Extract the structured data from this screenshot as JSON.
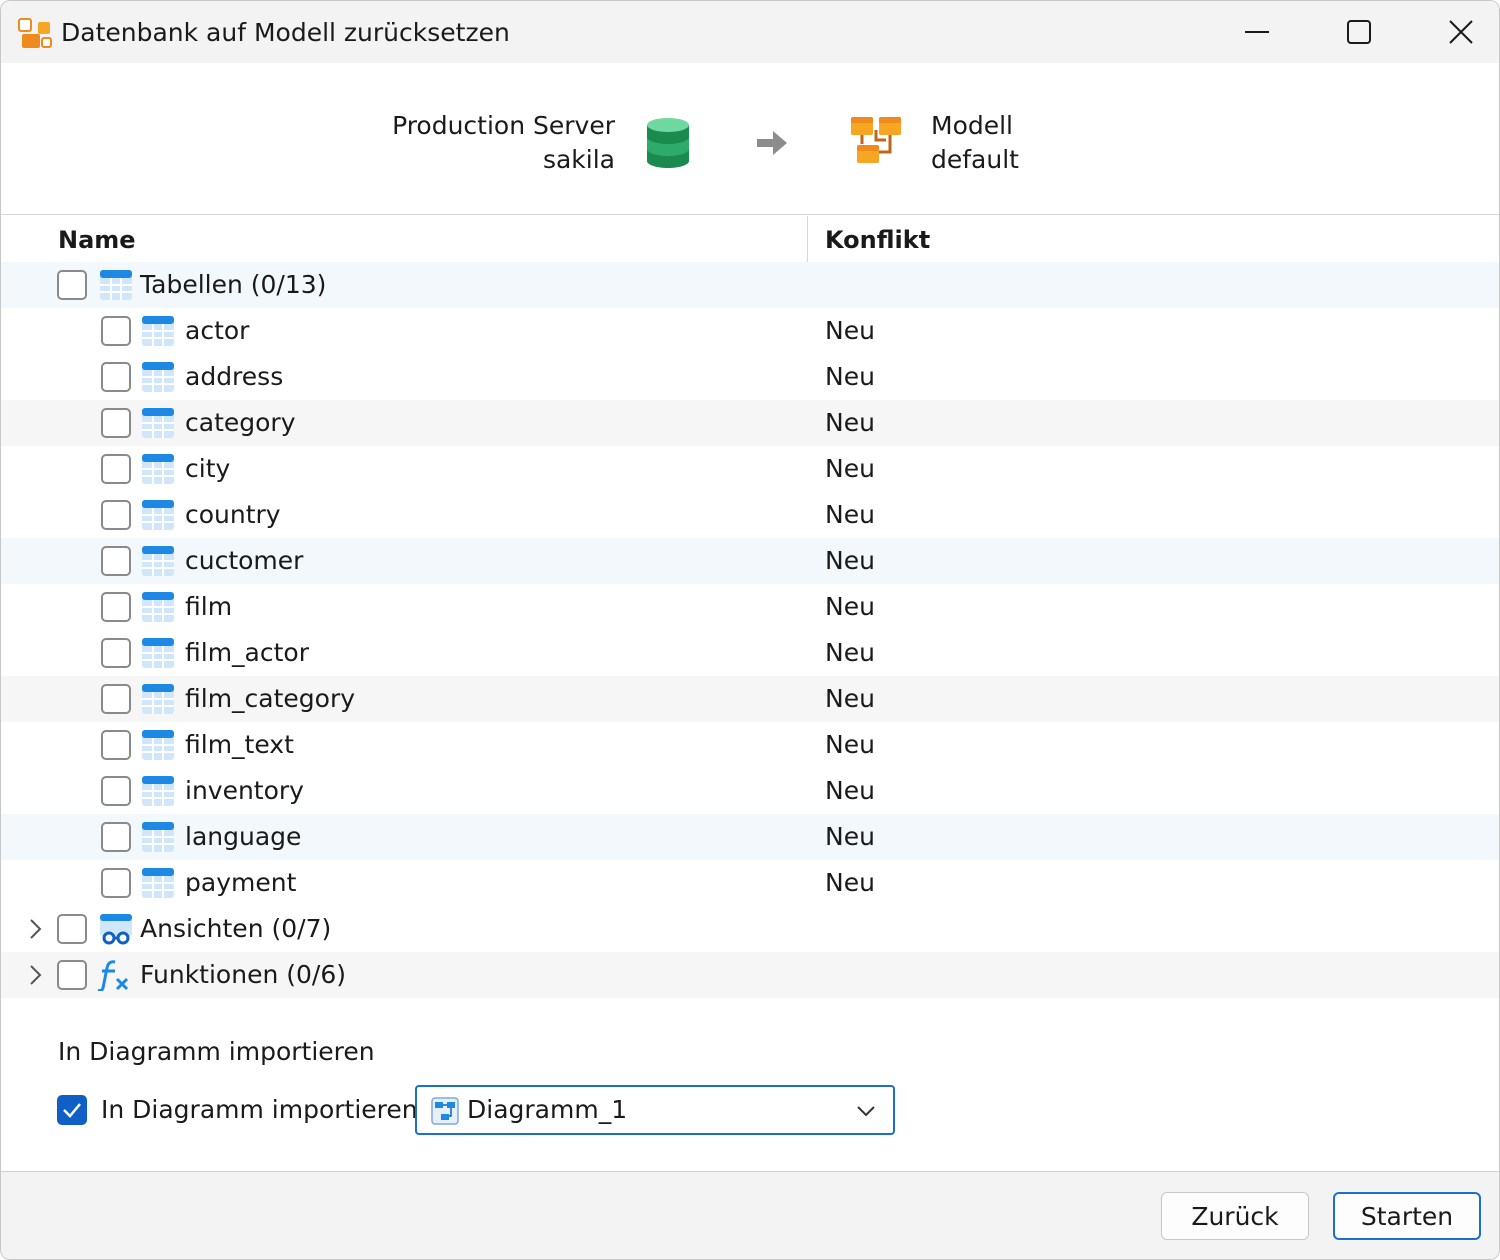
{
  "window": {
    "title": "Datenbank auf Modell zurücksetzen",
    "icons": {
      "app": "model-sync-icon",
      "minimize": "minimize-icon",
      "maximize": "maximize-icon",
      "close": "close-icon"
    }
  },
  "header": {
    "source_name": "Production Server",
    "source_db": "sakila",
    "target_name": "Modell",
    "target_db": "default",
    "icons": {
      "source": "database-icon",
      "arrow": "arrow-right-icon",
      "target": "model-icon"
    }
  },
  "table": {
    "columns": [
      "Name",
      "Konflikt"
    ],
    "groups": [
      {
        "label": "Tabellen (0/13)",
        "icon": "table-icon",
        "expanded": true,
        "items": [
          {
            "name": "actor",
            "conflict": "Neu"
          },
          {
            "name": "address",
            "conflict": "Neu"
          },
          {
            "name": "category",
            "conflict": "Neu"
          },
          {
            "name": "city",
            "conflict": "Neu"
          },
          {
            "name": "country",
            "conflict": "Neu"
          },
          {
            "name": "cuctomer",
            "conflict": "Neu"
          },
          {
            "name": "film",
            "conflict": "Neu"
          },
          {
            "name": "film_actor",
            "conflict": "Neu"
          },
          {
            "name": "film_category",
            "conflict": "Neu"
          },
          {
            "name": "film_text",
            "conflict": "Neu"
          },
          {
            "name": "inventory",
            "conflict": "Neu"
          },
          {
            "name": "language",
            "conflict": "Neu"
          },
          {
            "name": "payment",
            "conflict": "Neu"
          }
        ]
      },
      {
        "label": "Ansichten (0/7)",
        "icon": "view-icon",
        "expanded": false
      },
      {
        "label": "Funktionen (0/6)",
        "icon": "function-icon",
        "expanded": false
      }
    ]
  },
  "import": {
    "heading": "In Diagramm importieren",
    "checkbox_label": "In Diagramm importieren",
    "checked": true,
    "diagram_value": "Diagramm_1",
    "icons": {
      "diagram": "diagram-icon",
      "dropdown": "chevron-down-icon"
    }
  },
  "footer": {
    "back_label": "Zurück",
    "start_label": "Starten"
  },
  "colors": {
    "accent": "#0f5fc6",
    "table_icon": "#1e88e5",
    "db_icon": "#2eaa6a",
    "model_icon": "#f5a623"
  }
}
